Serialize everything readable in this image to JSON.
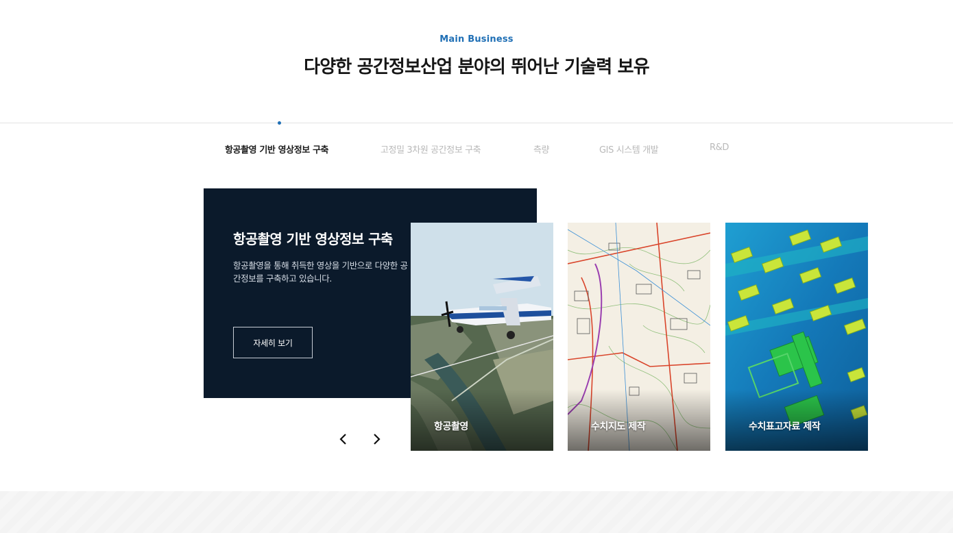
{
  "header": {
    "eyebrow": "Main Business",
    "title": "다양한 공간정보산업 분야의 뛰어난 기술력 보유"
  },
  "tabs": [
    {
      "label": "항공촬영 기반 영상정보 구축",
      "active": true
    },
    {
      "label": "고정밀 3차원 공간정보 구축",
      "active": false
    },
    {
      "label": "측량",
      "active": false
    },
    {
      "label": "GIS 시스템 개발",
      "active": false
    },
    {
      "label": "R&D",
      "active": false
    }
  ],
  "panel": {
    "title": "항공촬영 기반 영상정보 구축",
    "description": "항공촬영을 통해 취득한 영상을 기반으로 다양한 공간정보를 구축하고 있습니다.",
    "button_label": "자세히 보기"
  },
  "cards": [
    {
      "label": "항공촬영",
      "image": "aircraft-over-aerial-photo"
    },
    {
      "label": "수치지도 제작",
      "image": "digital-topographic-map"
    },
    {
      "label": "수치표고자료 제작",
      "image": "elevation-model-buildings"
    }
  ],
  "icons": {
    "prev": "chevron-left-icon",
    "next": "chevron-right-icon"
  },
  "colors": {
    "accent": "#1f6fb5",
    "panel": "#0b1a2b",
    "tab_inactive": "#b9b9b9"
  }
}
